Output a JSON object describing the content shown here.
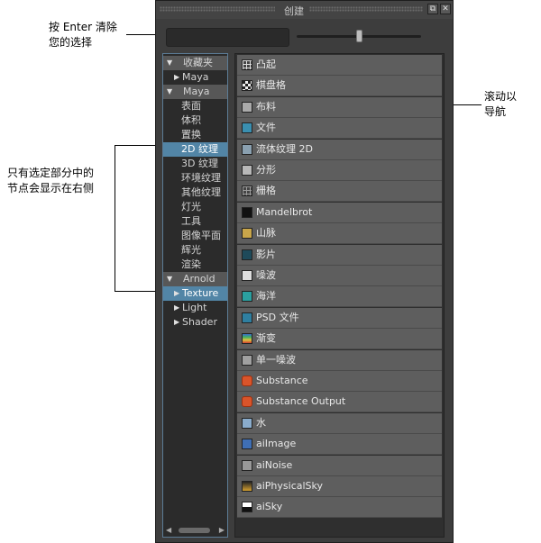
{
  "annotations": {
    "top_left": [
      "按 Enter 清除",
      "您的选择"
    ],
    "right": [
      "滚动以",
      "导航"
    ],
    "left": [
      "只有选定部分中的",
      "节点会显示在右侧"
    ]
  },
  "panel": {
    "title": "创建",
    "float_button": "⧉",
    "close_button": "✕",
    "search": {
      "value": "",
      "placeholder": ""
    },
    "icon_size_slider": {
      "value_fraction": 0.5
    }
  },
  "tree": [
    {
      "label": "收藏夹",
      "kind": "header",
      "expanded": true
    },
    {
      "label": "Maya",
      "kind": "child",
      "arrow": "collapsed"
    },
    {
      "label": "Maya",
      "kind": "header",
      "expanded": true
    },
    {
      "label": "表面",
      "kind": "sub"
    },
    {
      "label": "体积",
      "kind": "sub"
    },
    {
      "label": "置换",
      "kind": "sub"
    },
    {
      "label": "2D 纹理",
      "kind": "sub",
      "selected": true
    },
    {
      "label": "3D 纹理",
      "kind": "sub"
    },
    {
      "label": "环境纹理",
      "kind": "sub"
    },
    {
      "label": "其他纹理",
      "kind": "sub"
    },
    {
      "label": "灯光",
      "kind": "sub"
    },
    {
      "label": "工具",
      "kind": "sub"
    },
    {
      "label": "图像平面",
      "kind": "sub"
    },
    {
      "label": "辉光",
      "kind": "sub"
    },
    {
      "label": "渲染",
      "kind": "sub"
    },
    {
      "label": "Arnold",
      "kind": "header",
      "expanded": true
    },
    {
      "label": "Texture",
      "kind": "child",
      "arrow": "collapsed",
      "selected": true
    },
    {
      "label": "Light",
      "kind": "child",
      "arrow": "collapsed"
    },
    {
      "label": "Shader",
      "kind": "child",
      "arrow": "collapsed"
    }
  ],
  "nodes": [
    {
      "label": "凸起",
      "icon": "bump-grid-icon",
      "color": "#dddddd"
    },
    {
      "label": "棋盘格",
      "icon": "checker-icon",
      "color": "#eeeeee"
    },
    {
      "label": "布料",
      "icon": "cloth-icon",
      "color": "#aaaaaa"
    },
    {
      "label": "文件",
      "icon": "file-image-icon",
      "color": "#3a8fb0"
    },
    {
      "label": "流体纹理 2D",
      "icon": "fluid-texture-icon",
      "color": "#8aa0b0"
    },
    {
      "label": "分形",
      "icon": "fractal-icon",
      "color": "#b8b8b8"
    },
    {
      "label": "栅格",
      "icon": "grid-icon",
      "color": "#9a9a9a"
    },
    {
      "label": "Mandelbrot",
      "icon": "mandelbrot-icon",
      "color": "#111111"
    },
    {
      "label": "山脉",
      "icon": "mountain-icon",
      "color": "#c9a64a"
    },
    {
      "label": "影片",
      "icon": "movie-icon",
      "color": "#1e4a5a"
    },
    {
      "label": "噪波",
      "icon": "noise-icon",
      "color": "#dddddd"
    },
    {
      "label": "海洋",
      "icon": "ocean-icon",
      "color": "#2aa0a0"
    },
    {
      "label": "PSD 文件",
      "icon": "psd-file-icon",
      "color": "#2f7fa0"
    },
    {
      "label": "渐变",
      "icon": "ramp-icon",
      "color": "#d06040"
    },
    {
      "label": "单一噪波",
      "icon": "simplex-noise-icon",
      "color": "#a0a0a0"
    },
    {
      "label": "Substance",
      "icon": "substance-icon",
      "color": "#d9542a"
    },
    {
      "label": "Substance Output",
      "icon": "substance-output-icon",
      "color": "#d9542a"
    },
    {
      "label": "水",
      "icon": "water-icon",
      "color": "#8aaccc"
    },
    {
      "label": "aiImage",
      "icon": "ai-image-icon",
      "color": "#3f6fb5"
    },
    {
      "label": "aiNoise",
      "icon": "ai-noise-icon",
      "color": "#999999"
    },
    {
      "label": "aiPhysicalSky",
      "icon": "ai-physical-sky-icon",
      "color": "#d4a030"
    },
    {
      "label": "aiSky",
      "icon": "ai-sky-icon",
      "color": "#eeeeee"
    }
  ]
}
